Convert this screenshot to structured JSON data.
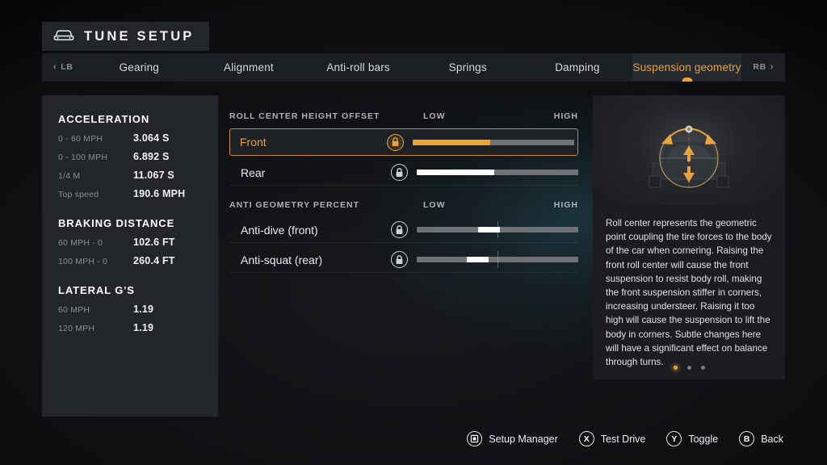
{
  "header": {
    "title": "TUNE SETUP",
    "icon": "car-icon"
  },
  "tabs": {
    "prev_bumper": "LB",
    "next_bumper": "RB",
    "items": [
      {
        "label": "Gearing",
        "active": false
      },
      {
        "label": "Alignment",
        "active": false
      },
      {
        "label": "Anti-roll bars",
        "active": false
      },
      {
        "label": "Springs",
        "active": false
      },
      {
        "label": "Damping",
        "active": false
      },
      {
        "label": "Suspension geometry",
        "active": true
      }
    ]
  },
  "stats": {
    "groups": [
      {
        "title": "ACCELERATION",
        "rows": [
          {
            "label": "0 - 60 MPH",
            "value": "3.064 S"
          },
          {
            "label": "0 - 100 MPH",
            "value": "6.892 S"
          },
          {
            "label": "1/4 M",
            "value": "11.067 S"
          },
          {
            "label": "Top speed",
            "value": "190.6 MPH"
          }
        ]
      },
      {
        "title": "BRAKING DISTANCE",
        "rows": [
          {
            "label": "60 MPH - 0",
            "value": "102.6 FT"
          },
          {
            "label": "100 MPH - 0",
            "value": "260.4 FT"
          }
        ]
      },
      {
        "title": "LATERAL G'S",
        "rows": [
          {
            "label": "60 MPH",
            "value": "1.19"
          },
          {
            "label": "120 MPH",
            "value": "1.19"
          }
        ]
      }
    ]
  },
  "settings": {
    "sections": [
      {
        "title": "ROLL CENTER HEIGHT OFFSET",
        "scale_low": "LOW",
        "scale_high": "HIGH",
        "rows": [
          {
            "name": "Front",
            "selected": true,
            "locked": true,
            "fill_percent": 48,
            "style": "fill"
          },
          {
            "name": "Rear",
            "selected": false,
            "locked": true,
            "fill_percent": 48,
            "style": "fill"
          }
        ]
      },
      {
        "title": "ANTI GEOMETRY PERCENT",
        "scale_low": "LOW",
        "scale_high": "HIGH",
        "rows": [
          {
            "name": "Anti-dive (front)",
            "selected": false,
            "locked": true,
            "knob_percent": 44,
            "tick_percent": 50,
            "style": "knob"
          },
          {
            "name": "Anti-squat (rear)",
            "selected": false,
            "locked": true,
            "knob_percent": 38,
            "tick_percent": 50,
            "style": "knob"
          }
        ]
      }
    ]
  },
  "info": {
    "diagram_icon": "roll-center-diagram",
    "description": "Roll center represents the geometric point coupling the tire forces to the body of the car when cornering. Raising the front roll center will cause the front suspension to resist body roll, making the front suspension stiffer in corners, increasing understeer. Raising it too high will cause the suspension to lift the body in corners. Subtle changes here will have a significant effect on balance through turns.",
    "page_dots": 3,
    "page_active": 1
  },
  "prompts": [
    {
      "button": "❐",
      "label": "Setup Manager",
      "name": "setup-manager"
    },
    {
      "button": "X",
      "label": "Test Drive",
      "name": "test-drive"
    },
    {
      "button": "Y",
      "label": "Toggle",
      "name": "toggle"
    },
    {
      "button": "B",
      "label": "Back",
      "name": "back"
    }
  ],
  "colors": {
    "accent": "#e8a33d",
    "panel": "#232629",
    "background": "#16181b"
  }
}
